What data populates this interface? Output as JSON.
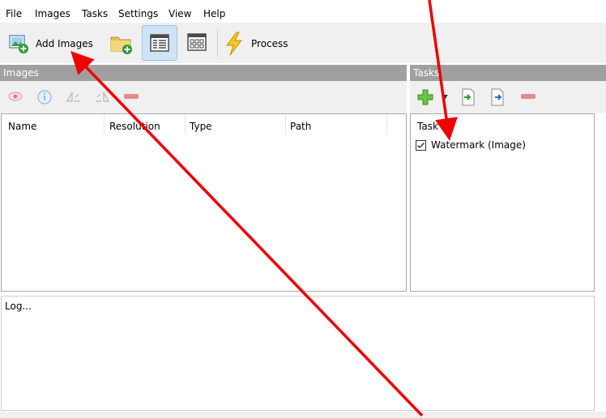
{
  "menu": {
    "items": [
      "File",
      "Images",
      "Tasks",
      "Settings",
      "View",
      "Help"
    ]
  },
  "toolbar": {
    "add_images": "Add Images",
    "process": "Process"
  },
  "images_panel": {
    "title": "Images",
    "columns": [
      "Name",
      "Resolution",
      "Type",
      "Path"
    ]
  },
  "tasks_panel": {
    "title": "Tasks",
    "column": "Task",
    "items": [
      {
        "label": "Watermark (Image)",
        "checked": true
      }
    ]
  },
  "log": {
    "text": "Log..."
  },
  "colors": {
    "section_header": "#a0a0a0",
    "arrow": "#ee0000",
    "accent": "#9bc3ea"
  }
}
